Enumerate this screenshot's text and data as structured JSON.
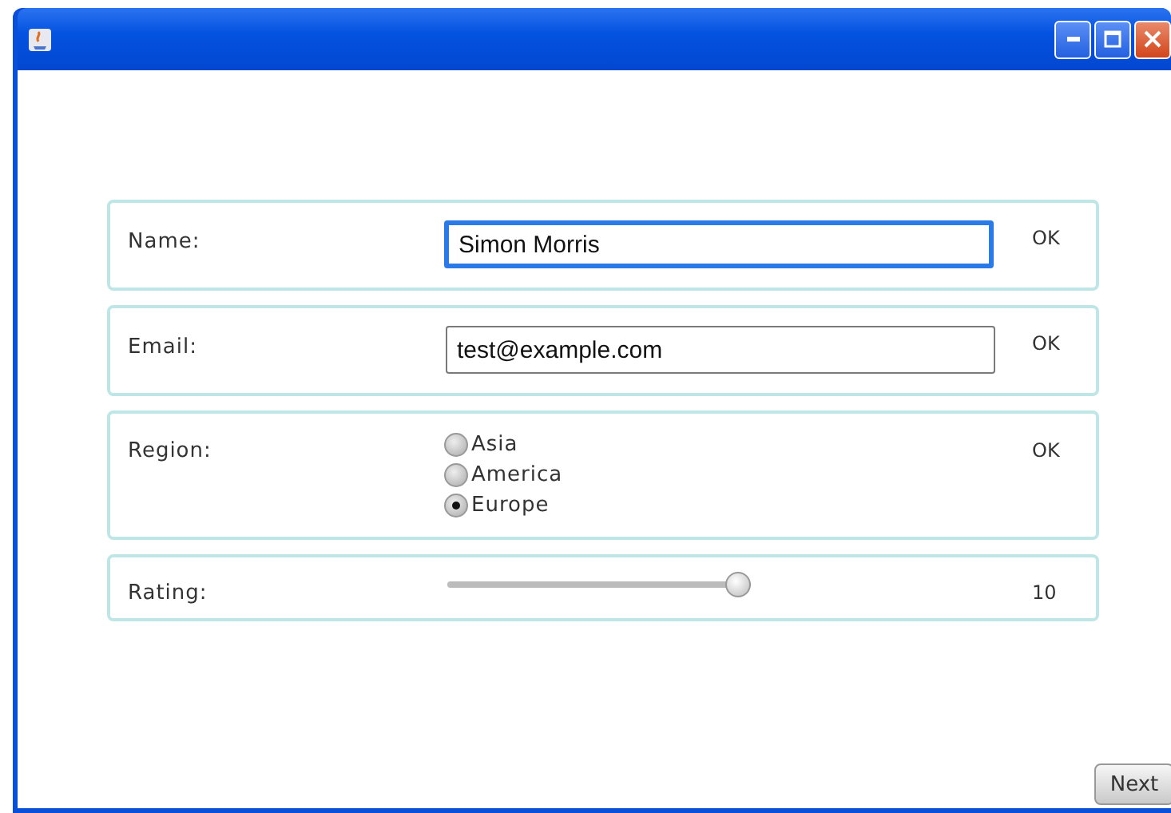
{
  "fields": [
    {
      "kind": "text",
      "label": "Name:",
      "value": "Simon Morris",
      "focused": true,
      "status": "OK"
    },
    {
      "kind": "text",
      "label": "Email:",
      "value": "test@example.com",
      "focused": false,
      "status": "OK"
    },
    {
      "kind": "radio",
      "label": "Region:",
      "options": [
        {
          "label": "Asia",
          "selected": false
        },
        {
          "label": "America",
          "selected": false
        },
        {
          "label": "Europe",
          "selected": true
        }
      ],
      "status": "OK"
    },
    {
      "kind": "slider",
      "label": "Rating:",
      "level": 1,
      "status": "10"
    }
  ],
  "buttons": [
    "Next"
  ]
}
